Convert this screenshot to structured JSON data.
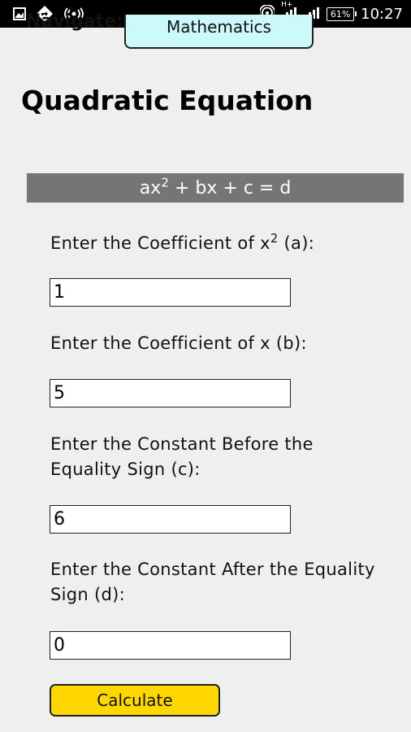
{
  "status_bar": {
    "time": "10:27",
    "battery": "61%",
    "network": "H+",
    "icons": [
      "image-icon",
      "navigation-icon",
      "wireless-icon",
      "hotspot-icon",
      "signal-icon",
      "signal-icon",
      "battery-icon"
    ]
  },
  "nav": {
    "label": "Navigate:",
    "selected": "Mathematics"
  },
  "title": "Quadratic Equation",
  "formula": {
    "prefix": "ax",
    "exponent": "2",
    "suffix": " + bx + c = d"
  },
  "fields": {
    "a": {
      "label_prefix": "Enter the Coefficient of x",
      "label_exponent": "2",
      "label_suffix": " (a):",
      "value": "1"
    },
    "b": {
      "label": "Enter the Coefficient of x (b):",
      "value": "5"
    },
    "c": {
      "label": "Enter the Constant Before the Equality Sign (c):",
      "value": "6"
    },
    "d": {
      "label": "Enter the Constant After the Equality Sign (d):",
      "value": "0"
    }
  },
  "calculate_label": "Calculate",
  "colors": {
    "status_bar": "#000000",
    "nav_select_bg": "#ccf9f9",
    "formula_bar_bg": "#757575",
    "button_bg": "#ffd700",
    "page_bg": "#efefef"
  }
}
